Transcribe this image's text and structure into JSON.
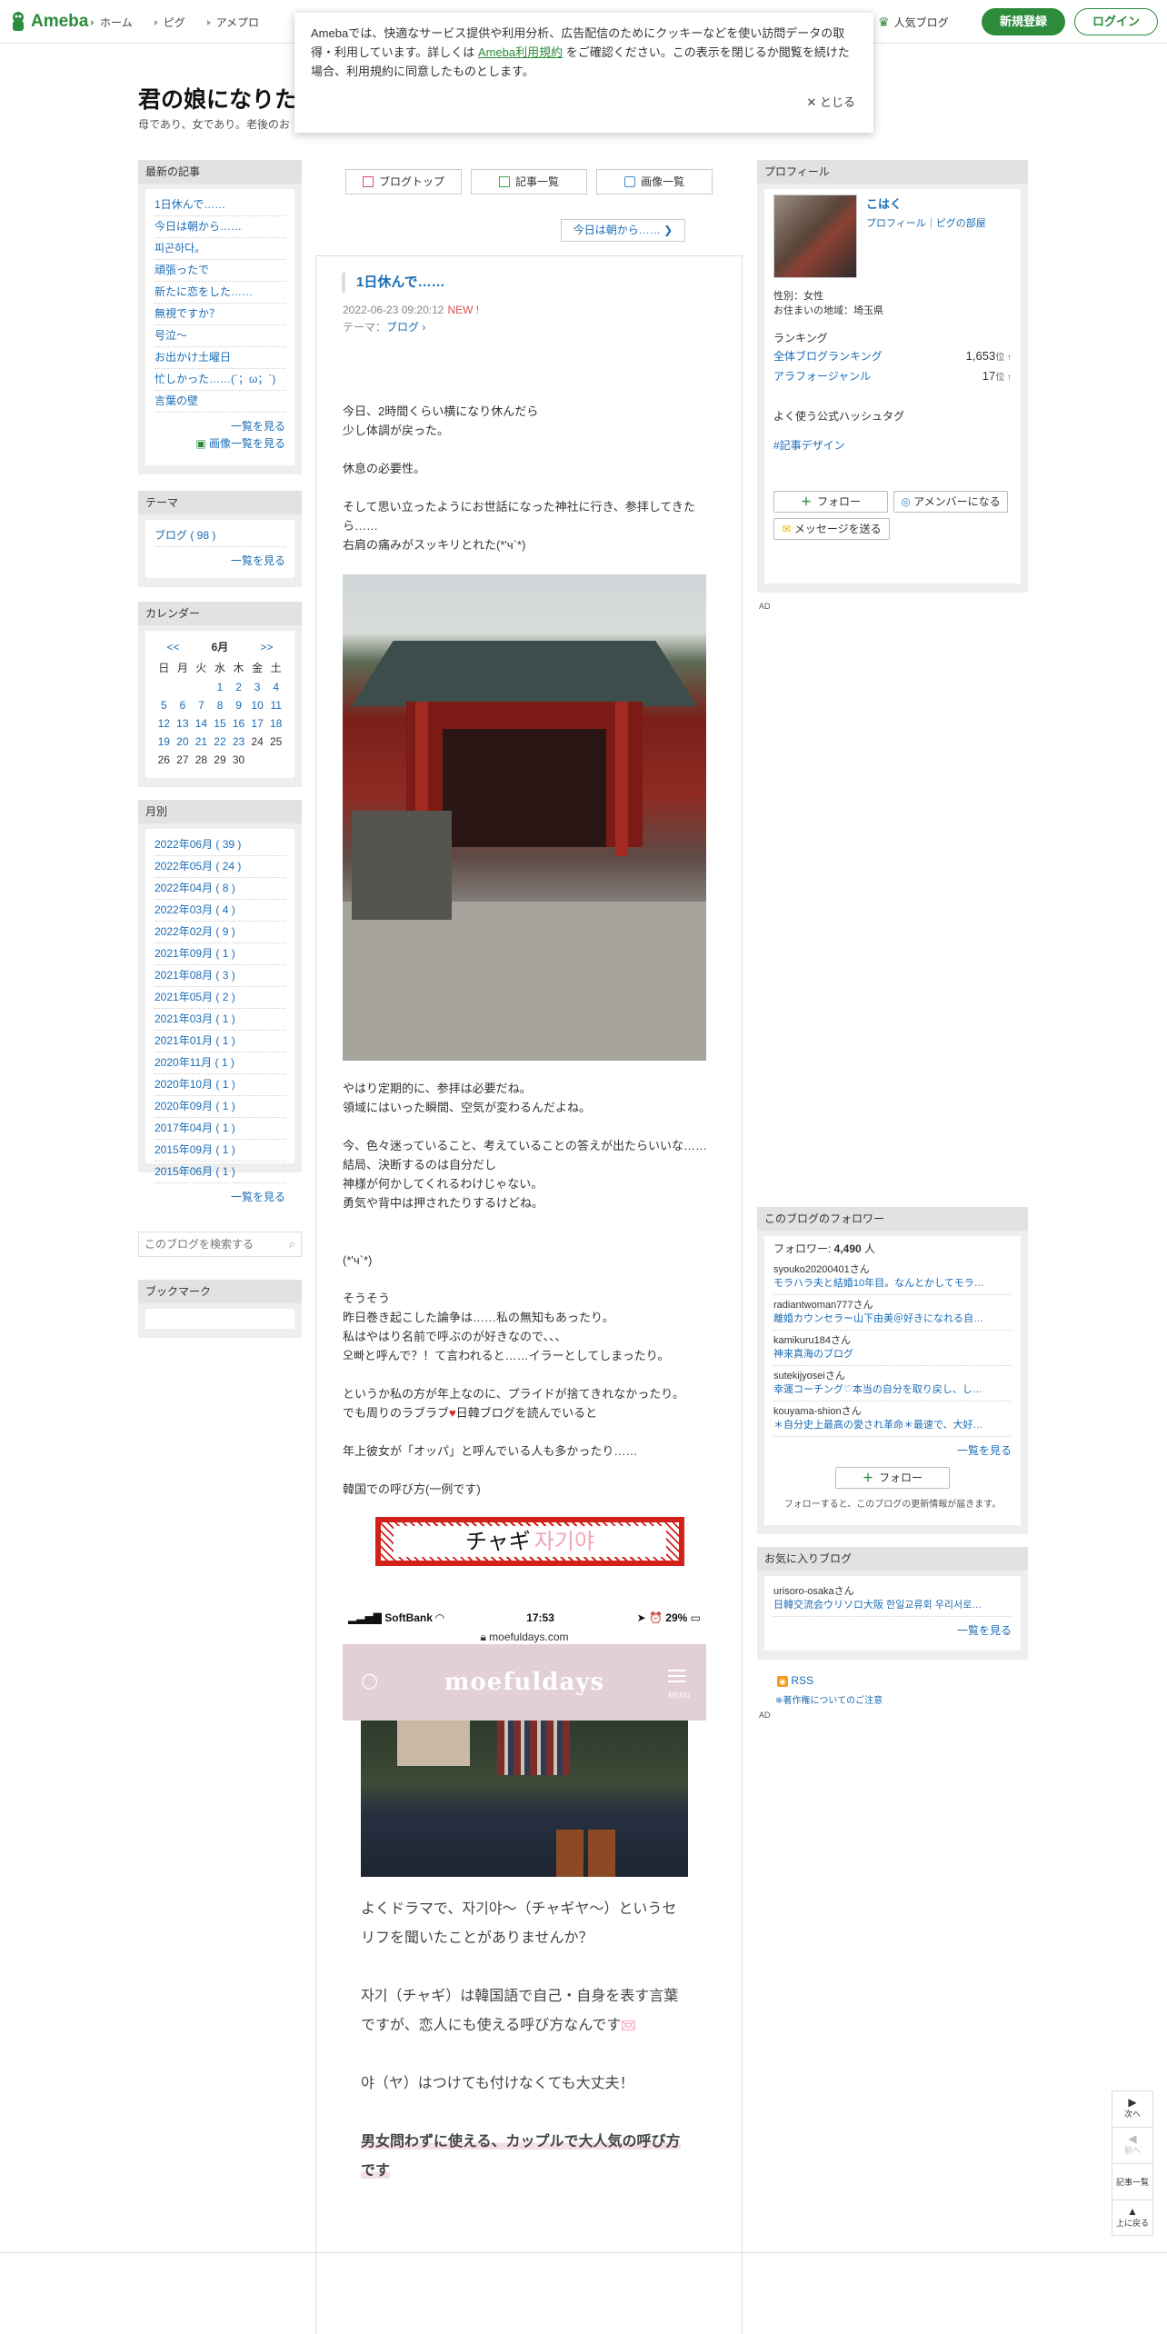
{
  "header": {
    "logo_text": "Ameba",
    "nav": [
      "ホーム",
      "ピグ",
      "アメプロ"
    ],
    "popular": "人気ブログ",
    "register": "新規登録",
    "login": "ログイン",
    "brand_color": "#2d8c3c"
  },
  "cookie": {
    "text_before": "Amebaでは、快適なサービス提供や利用分析、広告配信のためにクッキーなどを使い訪問データの取得・利用しています。詳しくは ",
    "link": "Ameba利用規約",
    "text_after": " をご確認ください。この表示を閉じるか閲覧を続けた場合、利用規約に同意したものとします。",
    "close": "とじる"
  },
  "blog": {
    "title": "君の娘になりた",
    "description": "母であり、女であり。老後のお"
  },
  "left": {
    "recent_header": "最新の記事",
    "recent": [
      "1日休んで……",
      "今日は朝から……",
      "피곤하다。",
      "頑張ったで",
      "新たに恋をした……",
      "無視ですか？",
      "号泣〜",
      "お出かけ土曜日",
      "忙しかった……(´；ω；`)",
      "言葉の壁"
    ],
    "recent_more": "一覧を見る",
    "image_more": "画像一覧を見る",
    "theme_header": "テーマ",
    "themes": [
      "ブログ ( 98 )"
    ],
    "theme_more": "一覧を見る",
    "calendar_header": "カレンダー",
    "calendar": {
      "prev": "<<",
      "month": "6月",
      "next": ">>",
      "weekdays": [
        "日",
        "月",
        "火",
        "水",
        "木",
        "金",
        "土"
      ],
      "weeks": [
        [
          "",
          "",
          "",
          "1",
          "2",
          "3",
          "4"
        ],
        [
          "5",
          "6",
          "7",
          "8",
          "9",
          "10",
          "11"
        ],
        [
          "12",
          "13",
          "14",
          "15",
          "16",
          "17",
          "18"
        ],
        [
          "19",
          "20",
          "21",
          "22",
          "23",
          "24",
          "25"
        ],
        [
          "26",
          "27",
          "28",
          "29",
          "30",
          "",
          ""
        ]
      ]
    },
    "monthly_header": "月別",
    "monthly": [
      "2022年06月 ( 39 )",
      "2022年05月 ( 24 )",
      "2022年04月 ( 8 )",
      "2022年03月 ( 4 )",
      "2022年02月 ( 9 )",
      "2021年09月 ( 1 )",
      "2021年08月 ( 3 )",
      "2021年05月 ( 2 )",
      "2021年03月 ( 1 )",
      "2021年01月 ( 1 )",
      "2020年11月 ( 1 )",
      "2020年10月 ( 1 )",
      "2020年09月 ( 1 )",
      "2017年04月 ( 1 )",
      "2015年09月 ( 1 )",
      "2015年06月 ( 1 )"
    ],
    "monthly_more": "一覧を見る",
    "search_placeholder": "このブログを検索する",
    "bookmark_header": "ブックマーク"
  },
  "center": {
    "tabs": [
      "ブログトップ",
      "記事一覧",
      "画像一覧"
    ],
    "prev_article": "今日は朝から……",
    "article": {
      "title": "1日休んで……",
      "date": "2022-06-23 09:20:12",
      "new": "NEW !",
      "theme_label": "テーマ：",
      "theme": "ブログ",
      "p1": [
        "今日、2時間くらい横になり休んだら",
        "少し体調が戻った。"
      ],
      "p2": [
        "休息の必要性。"
      ],
      "p3": [
        "そして思い立ったようにお世話になった神社に行き、参拝してきたら……",
        "右肩の痛みがスッキリとれた(*'ч`*)"
      ],
      "p4": [
        "やはり定期的に、参拝は必要だね。",
        "領域にはいった瞬間、空気が変わるんだよね。"
      ],
      "p5": [
        "今、色々迷っていること、考えていることの答えが出たらいいな……",
        "結局、決断するのは自分だし",
        "神様が何かしてくれるわけじゃない。",
        "勇気や背中は押されたりするけどね。"
      ],
      "p6": [
        "(*'ч`*)"
      ],
      "p7": [
        "そうそう",
        "昨日巻き起こした論争は……私の無知もあったり。",
        "私はやはり名前で呼ぶのが好きなので、、、",
        "오빠と呼んで？！て言われると……イラーとしてしまったり。"
      ],
      "p8": [
        "というか私の方が年上なのに、プライドが捨てきれなかったり。",
        "でも周りのラブラブ",
        "日韓ブログを読んでいると"
      ],
      "p9": [
        "年上彼女が「オッパ」と呼んでいる人も多かったり……"
      ],
      "p10": [
        "韓国での呼び方(一例です)"
      ],
      "banner_jp": "チャギ",
      "banner_kr": "자기야",
      "phone": {
        "carrier": "SoftBank",
        "time": "17:53",
        "battery": "29%",
        "url": "moefuldays.com",
        "site": "moefuldays",
        "menu": "MENU",
        "t1": "よくドラマで、자기야〜（チャギヤ〜）というセリフを聞いたことがありませんか？",
        "t2": "자기（チャギ）は韓国語で自己・自身を表す言葉ですが、恋人にも使える呼び方なんです",
        "t3": "야（ヤ）はつけても付けなくても大丈夫！",
        "t4": "男女問わずに使える、カップルで大人気の呼び方です"
      }
    }
  },
  "right": {
    "profile_header": "プロフィール",
    "name": "こはく",
    "links": "プロフィール｜ピグの部屋",
    "gender": "性別：女性",
    "residence": "お住まいの地域：埼玉県",
    "ranking_label": "ランキング",
    "rank1_label": "全体ブログランキング",
    "rank1_value": "1,653",
    "rank2_label": "アラフォージャンル",
    "rank2_value": "17",
    "rank_unit": "位",
    "hashtag_label": "よく使う公式ハッシュタグ",
    "hashtag": "#記事デザイン",
    "follow": "フォロー",
    "member": "アメンバーになる",
    "message": "メッセージを送る",
    "ad": "AD",
    "followers_header": "このブログのフォロワー",
    "followers_label": "フォロワー: ",
    "followers_count": "4,490",
    "followers_unit": " 人",
    "followers": [
      {
        "user": "syouko20200401さん",
        "blog": "モラハラ夫と結婚10年目。なんとかしてモラ…"
      },
      {
        "user": "radiantwoman777さん",
        "blog": "離婚カウンセラー山下由美＠好きになれる自…"
      },
      {
        "user": "kamikuru184さん",
        "blog": "神来真海のブログ"
      },
      {
        "user": "sutekijyoseiさん",
        "blog": "幸運コーチング♡本当の自分を取り戻し、し…"
      },
      {
        "user": "kouyama-shionさん",
        "blog": "＊自分史上最高の愛され革命＊最速で、大好…"
      }
    ],
    "followers_more": "一覧を見る",
    "follow_note": "フォローすると、このブログの更新情報が届きます。",
    "fav_header": "お気に入りブログ",
    "fav_user": "urisoro-osakaさん",
    "fav_blog": "日韓交流会ウリソロ大阪 한일교류회 우리서로…",
    "fav_more": "一覧を見る",
    "rss": "RSS",
    "copyright": "※著作権についてのご注意"
  },
  "floatnav": {
    "next": "次へ",
    "prev": "前へ",
    "list": "記事一覧",
    "top": "上に戻る"
  }
}
